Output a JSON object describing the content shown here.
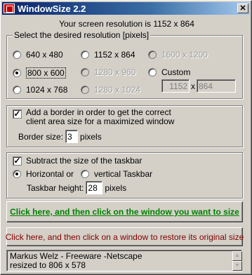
{
  "window": {
    "title": "WindowSize 2.2",
    "close_glyph": "✕"
  },
  "resolution_line": "Your screen resolution is 1152 x 864",
  "res_group": {
    "title": "Select the desired resolution [pixels]",
    "options": [
      {
        "label": "640 x 480",
        "selected": false,
        "enabled": true
      },
      {
        "label": "1152 x 864",
        "selected": false,
        "enabled": true
      },
      {
        "label": "1600 x 1200",
        "selected": false,
        "enabled": false
      },
      {
        "label": "800 x 600",
        "selected": true,
        "enabled": true
      },
      {
        "label": "1280 x 960",
        "selected": false,
        "enabled": false
      },
      {
        "label": "Custom",
        "selected": false,
        "enabled": true
      },
      {
        "label": "1024 x 768",
        "selected": false,
        "enabled": true
      },
      {
        "label": "1280 x 1024",
        "selected": false,
        "enabled": false
      }
    ],
    "custom_width": "1152",
    "custom_x": "x",
    "custom_height": "864"
  },
  "border_group": {
    "checkbox_label_line1": "Add a border in order to get the correct",
    "checkbox_label_line2": "client area size for a maximized window",
    "checked": true,
    "size_label": "Border size:",
    "size_value": "3",
    "size_unit": "pixels"
  },
  "taskbar_group": {
    "checkbox_label": "Subtract the size of the taskbar",
    "checked": true,
    "horizontal_label": "Horizontal or",
    "vertical_label": "vertical Taskbar",
    "horizontal_selected": true,
    "height_label": "Taskbar height:",
    "height_value": "28",
    "height_unit": "pixels"
  },
  "buttons": {
    "size_label": "Click here, and then click on the window you want to size",
    "restore_label": "Click here, and then click on a window to restore its original size"
  },
  "status": {
    "line1": "Markus Welz - Freeware -Netscape",
    "line2": "resized to 806 x 578"
  },
  "colors": {
    "titlebar": "#0a246a",
    "size_button_text": "#008000",
    "restore_button_text": "#800000",
    "face": "#d4d0c8"
  }
}
